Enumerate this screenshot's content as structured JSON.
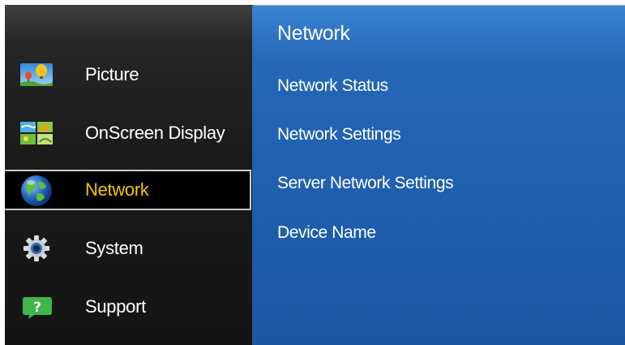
{
  "menu": {
    "items": [
      {
        "label": "Picture",
        "icon": "picture-icon"
      },
      {
        "label": "OnScreen Display",
        "icon": "onscreen-display-icon"
      },
      {
        "label": "Network",
        "icon": "globe-icon",
        "selected": true
      },
      {
        "label": "System",
        "icon": "gear-icon"
      },
      {
        "label": "Support",
        "icon": "question-icon"
      }
    ]
  },
  "submenu": {
    "title": "Network",
    "items": [
      {
        "label": "Network Status"
      },
      {
        "label": "Network Settings"
      },
      {
        "label": "Server Network Settings"
      },
      {
        "label": "Device Name"
      }
    ]
  },
  "colors": {
    "selected_text": "#f2c500",
    "panel_blue": "#1f5eae",
    "sidebar_bg": "#1a1a1a"
  }
}
